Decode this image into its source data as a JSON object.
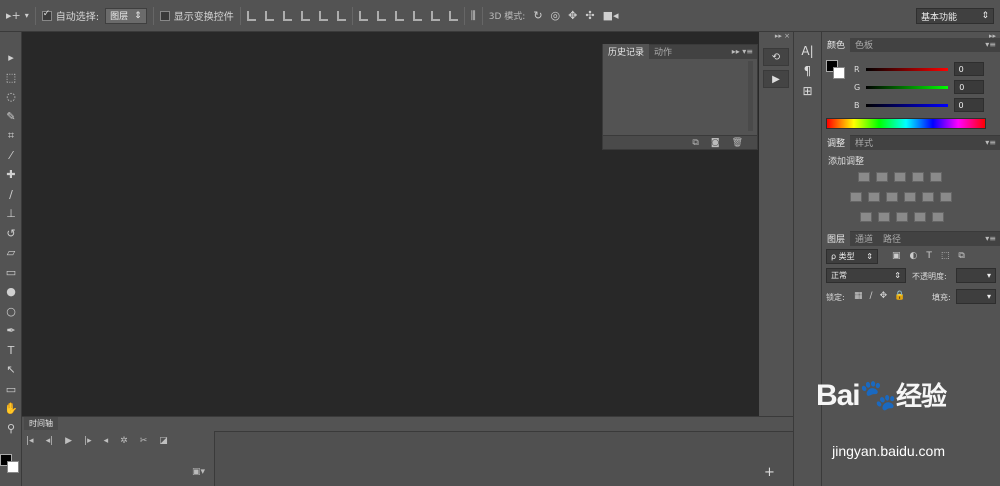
{
  "options_bar": {
    "move_tool": "▸+",
    "auto_select_label": "自动选择:",
    "auto_select_value": "图层",
    "show_transform_label": "显示变换控件",
    "mode_3d_label": "3D 模式:",
    "workspace": "基本功能"
  },
  "history_panel": {
    "tabs": [
      "历史记录",
      "动作"
    ]
  },
  "color_panel": {
    "tabs": [
      "颜色",
      "色板"
    ],
    "r_label": "R",
    "r_value": "0",
    "g_label": "G",
    "g_value": "0",
    "b_label": "B",
    "b_value": "0"
  },
  "adjustments_panel": {
    "tabs": [
      "调整",
      "样式"
    ],
    "title": "添加调整"
  },
  "layers_panel": {
    "tabs": [
      "图层",
      "通道",
      "路径"
    ],
    "filter_type": "ρ 类型",
    "blend_mode": "正常",
    "opacity_label": "不透明度:",
    "lock_label": "锁定:",
    "fill_label": "填充:"
  },
  "timeline": {
    "tab": "时间轴",
    "add": "+"
  },
  "dock": {
    "char": "A|",
    "para": "¶"
  },
  "watermark": {
    "brand": "Bai",
    "brand2": "经验",
    "url": "jingyan.baidu.com"
  },
  "colors": {
    "canvas_bg": "#282828",
    "panel_bg": "#535353",
    "foreground": "#000000",
    "background": "#ffffff"
  }
}
